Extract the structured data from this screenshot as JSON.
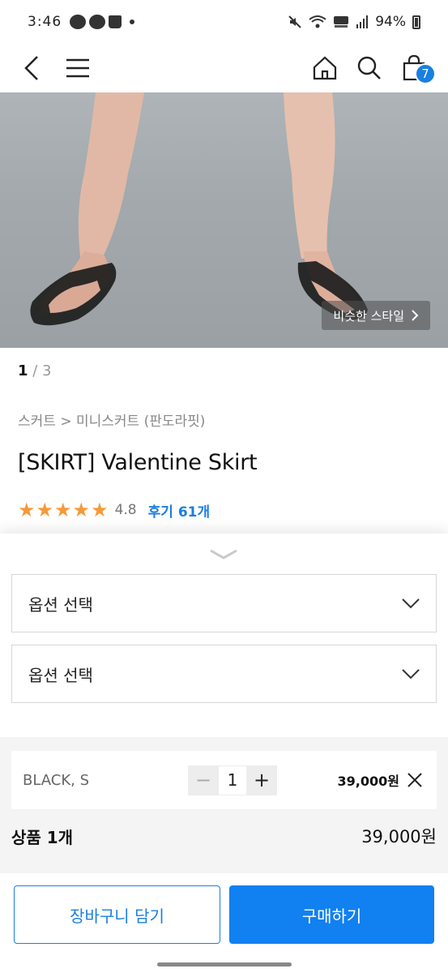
{
  "status_bar": {
    "time": "3:46",
    "battery": "94%"
  },
  "header": {
    "back_icon": "chevron-left-icon",
    "menu_icon": "hamburger-icon",
    "home_icon": "home-icon",
    "search_icon": "search-icon",
    "cart_icon": "shopping-bag-icon",
    "cart_count": "7"
  },
  "product": {
    "similar_style_label": "비슷한 스타일",
    "pager_current": "1",
    "pager_total": "/ 3",
    "breadcrumb": "스커트 > 미니스커트 (판도라핏)",
    "title": "[SKIRT] Valentine Skirt",
    "rating": "4.8",
    "stars": 5,
    "reviews_label": "후기 61개"
  },
  "options": {
    "select1_label": "옵션 선택",
    "select2_label": "옵션 선택"
  },
  "selection": {
    "item_label": "BLACK, S",
    "quantity": "1",
    "minus_label": "−",
    "plus_label": "+",
    "item_price": "39,000원",
    "total_label": "상품 1개",
    "total_price": "39,000원"
  },
  "actions": {
    "cart_label": "장바구니 담기",
    "buy_label": "구매하기"
  },
  "colors": {
    "accent": "#1180f0",
    "star": "#f59a3a",
    "badge": "#1a7fe0"
  }
}
